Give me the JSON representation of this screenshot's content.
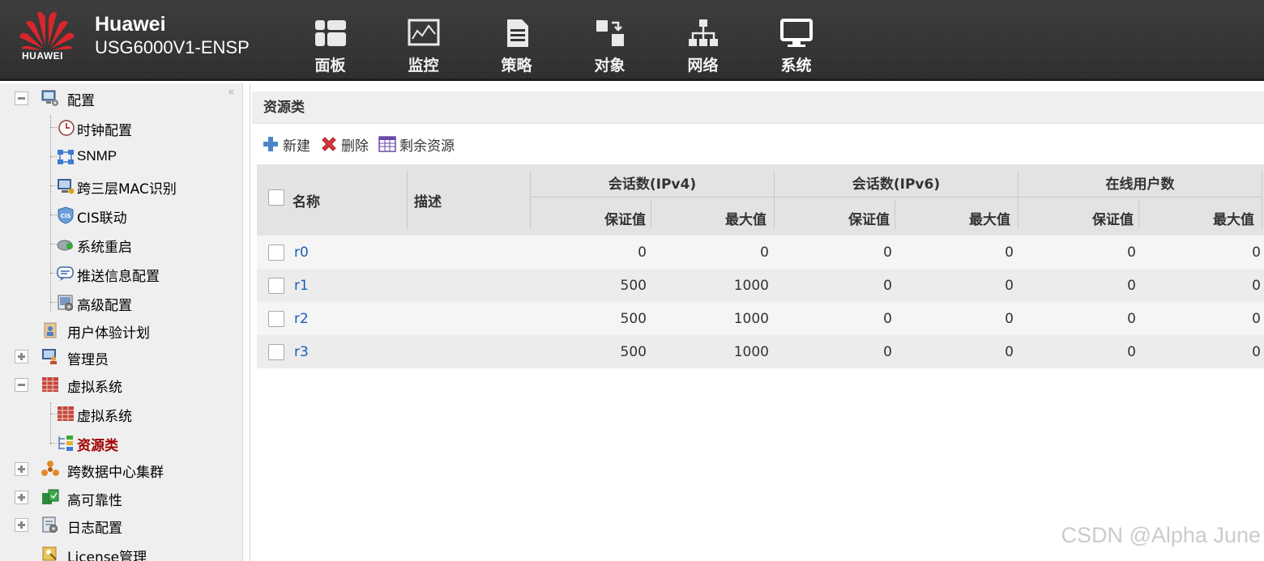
{
  "header": {
    "brand_name": "Huawei",
    "model": "USG6000V1-ENSP",
    "logo_text": "HUAWEI",
    "nav": [
      {
        "label": "面板",
        "icon": "dashboard-icon"
      },
      {
        "label": "监控",
        "icon": "monitor-icon"
      },
      {
        "label": "策略",
        "icon": "policy-icon"
      },
      {
        "label": "对象",
        "icon": "object-icon"
      },
      {
        "label": "网络",
        "icon": "network-icon"
      },
      {
        "label": "系统",
        "icon": "system-icon",
        "active": true
      }
    ]
  },
  "sidebar": {
    "collapse_glyph": "«",
    "items": [
      {
        "label": "配置",
        "icon": "config-icon",
        "expand": "minus"
      },
      {
        "label": "时钟配置",
        "icon": "clock-icon"
      },
      {
        "label": "SNMP",
        "icon": "snmp-icon"
      },
      {
        "label": "跨三层MAC识别",
        "icon": "mac-identify-icon"
      },
      {
        "label": "CIS联动",
        "icon": "cis-icon"
      },
      {
        "label": "系统重启",
        "icon": "restart-icon"
      },
      {
        "label": "推送信息配置",
        "icon": "push-message-icon"
      },
      {
        "label": "高级配置",
        "icon": "advanced-config-icon"
      },
      {
        "label": "用户体验计划",
        "icon": "user-experience-icon"
      },
      {
        "label": "管理员",
        "icon": "admin-icon",
        "expand": "plus"
      },
      {
        "label": "虚拟系统",
        "icon": "virtual-system-icon",
        "expand": "minus"
      },
      {
        "label": "虚拟系统",
        "icon": "virtual-system-icon"
      },
      {
        "label": "资源类",
        "icon": "resource-class-icon",
        "selected": true
      },
      {
        "label": "跨数据中心集群",
        "icon": "cluster-icon",
        "expand": "plus"
      },
      {
        "label": "高可靠性",
        "icon": "high-availability-icon",
        "expand": "plus"
      },
      {
        "label": "日志配置",
        "icon": "log-config-icon",
        "expand": "plus"
      },
      {
        "label": "License管理",
        "icon": "license-icon"
      }
    ]
  },
  "main": {
    "title": "资源类",
    "toolbar": {
      "new_label": "新建",
      "delete_label": "删除",
      "remaining_label": "剩余资源"
    },
    "table": {
      "col_name": "名称",
      "col_desc": "描述",
      "group_ipv4": "会话数(IPv4)",
      "group_ipv6": "会话数(IPv6)",
      "group_users": "在线用户数",
      "sub_guarantee": "保证值",
      "sub_max": "最大值",
      "rows": [
        {
          "name": "r0",
          "desc": "",
          "ipv4_guarantee": "0",
          "ipv4_max": "0",
          "ipv6_guarantee": "0",
          "ipv6_max": "0",
          "users_guarantee": "0",
          "users_max": "0"
        },
        {
          "name": "r1",
          "desc": "",
          "ipv4_guarantee": "500",
          "ipv4_max": "1000",
          "ipv6_guarantee": "0",
          "ipv6_max": "0",
          "users_guarantee": "0",
          "users_max": "0"
        },
        {
          "name": "r2",
          "desc": "",
          "ipv4_guarantee": "500",
          "ipv4_max": "1000",
          "ipv6_guarantee": "0",
          "ipv6_max": "0",
          "users_guarantee": "0",
          "users_max": "0"
        },
        {
          "name": "r3",
          "desc": "",
          "ipv4_guarantee": "500",
          "ipv4_max": "1000",
          "ipv6_guarantee": "0",
          "ipv6_max": "0",
          "users_guarantee": "0",
          "users_max": "0"
        }
      ]
    }
  },
  "watermark": "CSDN @Alpha June",
  "colors": {
    "header_bg": "#2f2f2f",
    "sidebar_bg": "#efefef",
    "selected_text": "#a10000",
    "link": "#1a5fb4",
    "brand_red": "#d8262c"
  }
}
